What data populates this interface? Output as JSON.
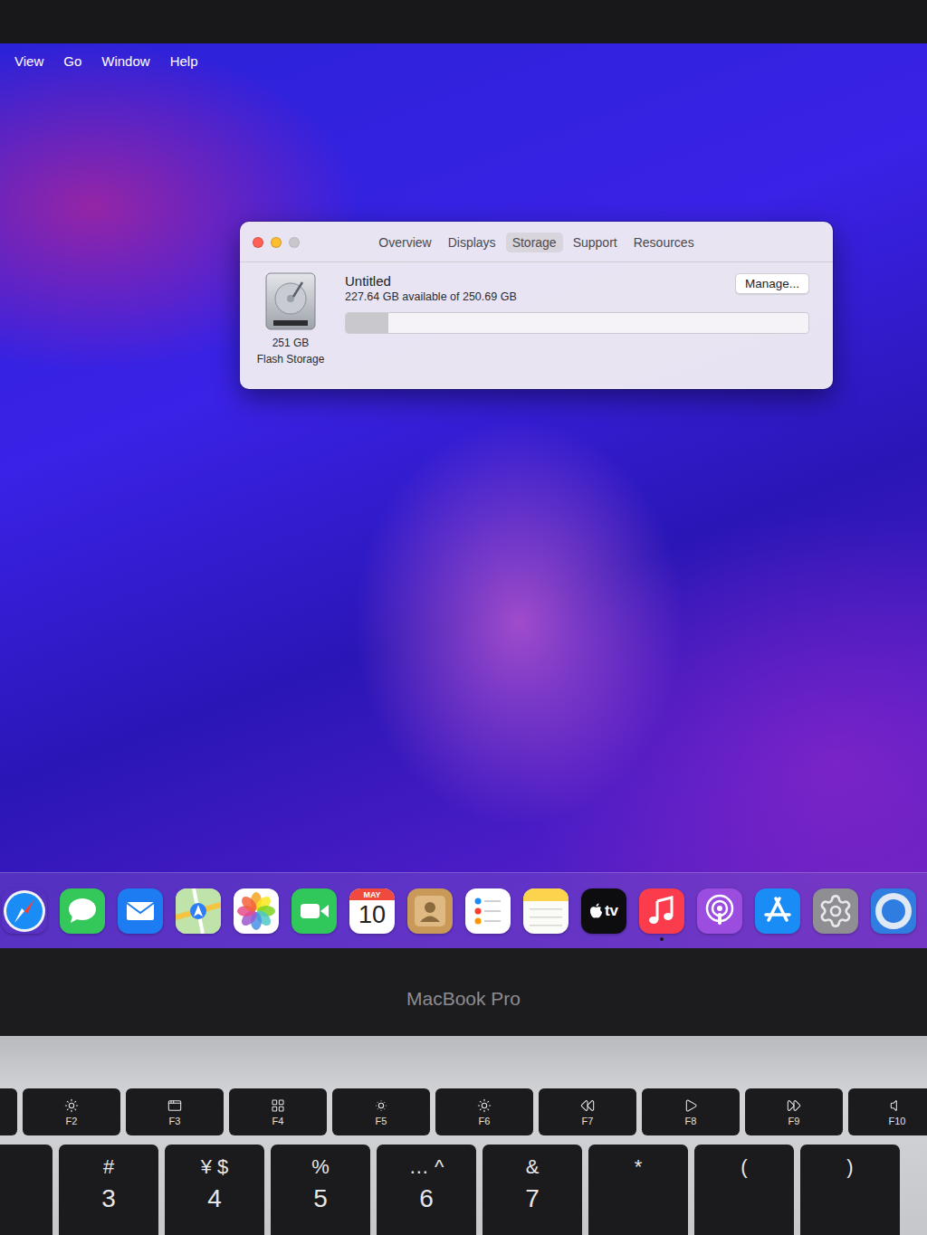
{
  "menu_bar": {
    "items": [
      "View",
      "Go",
      "Window",
      "Help"
    ]
  },
  "window": {
    "traffic_lights": [
      {
        "kind": "close",
        "disabled": false,
        "color": "#ff5f57"
      },
      {
        "kind": "minimize",
        "disabled": false,
        "color": "#febc2e"
      },
      {
        "kind": "zoom",
        "disabled": true,
        "color": "#c9c7cc"
      }
    ],
    "tabs": [
      {
        "label": "Overview",
        "selected": false
      },
      {
        "label": "Displays",
        "selected": false
      },
      {
        "label": "Storage",
        "selected": true
      },
      {
        "label": "Support",
        "selected": false
      },
      {
        "label": "Resources",
        "selected": false
      }
    ],
    "disk": {
      "capacity": "251 GB",
      "type": "Flash Storage",
      "name": "Untitled",
      "detail": "227.64 GB available of 250.69 GB",
      "level": 0.092,
      "button": "Manage..."
    }
  },
  "dock": {
    "items": [
      {
        "kind": "safari",
        "color": "#1a8cf5",
        "running": false
      },
      {
        "kind": "messages",
        "color": "#34c759",
        "running": false
      },
      {
        "kind": "mail",
        "color": "#1e7cf2",
        "running": false
      },
      {
        "kind": "maps",
        "color": "#e6eedf",
        "running": false
      },
      {
        "kind": "photos",
        "color": "#ffffff",
        "running": false
      },
      {
        "kind": "facetime",
        "color": "#30c85a",
        "running": false
      },
      {
        "kind": "calendar",
        "color": "#ffffff",
        "running": false,
        "month": "MAY",
        "day": "10"
      },
      {
        "kind": "contacts",
        "color": "#c9995a",
        "running": false
      },
      {
        "kind": "reminders",
        "color": "#ffffff",
        "running": false
      },
      {
        "kind": "notes",
        "color": "#fbfbf7",
        "running": false
      },
      {
        "kind": "tv",
        "color": "#0d0d0f",
        "running": false,
        "label": "tv"
      },
      {
        "kind": "music",
        "color": "#fa3c4c",
        "running": true
      },
      {
        "kind": "podcasts",
        "color": "#9b4de0",
        "running": false
      },
      {
        "kind": "appstore",
        "color": "#1a8cf5",
        "running": false
      },
      {
        "kind": "settings",
        "color": "#8e8e93",
        "running": false
      },
      {
        "kind": "partial",
        "color": "#2f7de1",
        "running": false
      }
    ]
  },
  "laptop": {
    "label": "MacBook Pro"
  },
  "keyboard": {
    "function_row": [
      {
        "kind": "blank"
      },
      {
        "kind": "brightness",
        "label": "F2"
      },
      {
        "kind": "mission",
        "label": "F3"
      },
      {
        "kind": "launchpad",
        "label": "F4"
      },
      {
        "kind": "kbd-down",
        "label": "F5"
      },
      {
        "kind": "kbd-up",
        "label": "F6"
      },
      {
        "kind": "rewind",
        "label": "F7"
      },
      {
        "kind": "play",
        "label": "F8"
      },
      {
        "kind": "forward",
        "label": "F9"
      },
      {
        "kind": "mute",
        "label": "F10"
      }
    ],
    "number_row": [
      {
        "kind": "blank"
      },
      {
        "kind": "key",
        "top": "#",
        "bottom": "3"
      },
      {
        "kind": "key",
        "top": "¥ $",
        "bottom": "4"
      },
      {
        "kind": "key",
        "top": "%",
        "bottom": "5"
      },
      {
        "kind": "key",
        "top": "… ^",
        "bottom": "6"
      },
      {
        "kind": "key",
        "top": "&",
        "bottom": "7"
      },
      {
        "kind": "key",
        "top": "*"
      },
      {
        "kind": "key",
        "top": "("
      },
      {
        "kind": "key",
        "top": ")"
      }
    ]
  }
}
